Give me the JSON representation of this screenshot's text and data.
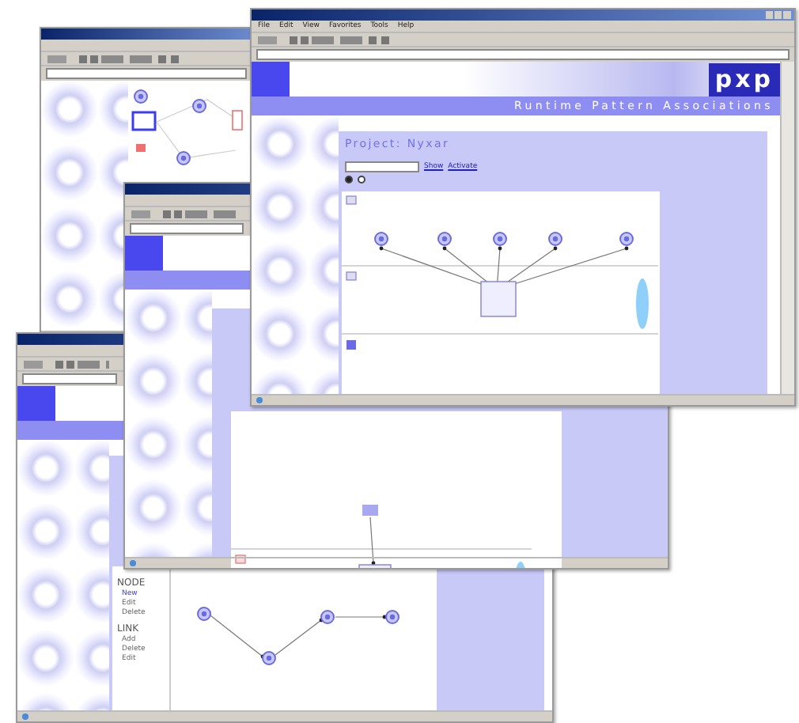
{
  "windows": [
    {
      "kind": "map"
    },
    {
      "kind": "editor",
      "node_menu": {
        "heading": "NODE",
        "items": [
          {
            "label": "New",
            "selected": true
          },
          {
            "label": "Edit",
            "selected": false
          },
          {
            "label": "Delete",
            "selected": false
          }
        ]
      },
      "link_menu": {
        "heading": "LINK",
        "items": [
          "Add",
          "Delete",
          "Edit"
        ]
      }
    },
    {
      "kind": "process"
    },
    {
      "kind": "project",
      "menu": [
        "File",
        "Edit",
        "View",
        "Favorites",
        "Tools",
        "Help"
      ],
      "logo": "pxp",
      "tagline": "Runtime Pattern Associations",
      "heading": "Project: Nyxar",
      "links": [
        "Show",
        "Activate"
      ],
      "modes": [
        {
          "selected": true
        },
        {
          "selected": false
        }
      ]
    }
  ]
}
